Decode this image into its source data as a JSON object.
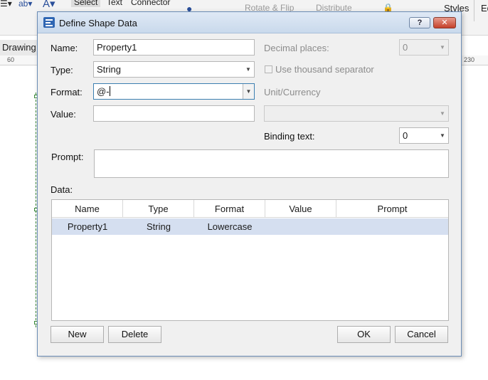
{
  "app": {
    "ribbon": {
      "select_label": "Select",
      "text_label": "Text",
      "connector_label": "Connector",
      "rotate_flip_label": "Rotate & Flip",
      "distribute_label": "Distribute",
      "styles_label": "Styles",
      "ed_label": "Ed"
    },
    "drawing_tab": "Drawing",
    "ruler": {
      "left_mark": "60",
      "right_mark": "230"
    }
  },
  "dialog": {
    "title": "Define Shape Data",
    "help_label": "?",
    "close_label": "✕",
    "name": {
      "label": "Name:",
      "value": "Property1"
    },
    "type": {
      "label": "Type:",
      "value": "String"
    },
    "format": {
      "label": "Format:",
      "value": "@-"
    },
    "value": {
      "label": "Value:",
      "value": ""
    },
    "decimal_places": {
      "label": "Decimal places:",
      "value": "0"
    },
    "thousand_separator": {
      "label": "Use thousand separator",
      "checked": false
    },
    "unit_currency": {
      "label": "Unit/Currency",
      "value": ""
    },
    "binding_text": {
      "label": "Binding text:",
      "value": "0"
    },
    "prompt": {
      "label": "Prompt:",
      "value": ""
    },
    "data_label": "Data:",
    "table": {
      "columns": [
        "Name",
        "Type",
        "Format",
        "Value",
        "Prompt"
      ],
      "rows": [
        [
          "Property1",
          "String",
          "Lowercase",
          "",
          ""
        ]
      ]
    },
    "buttons": {
      "new_label": "New",
      "delete_label": "Delete",
      "ok_label": "OK",
      "cancel_label": "Cancel"
    }
  },
  "colors": {
    "selected_row": "#d5dff0",
    "focus_border": "#3c7fb1",
    "close_button": "#c5412b"
  }
}
